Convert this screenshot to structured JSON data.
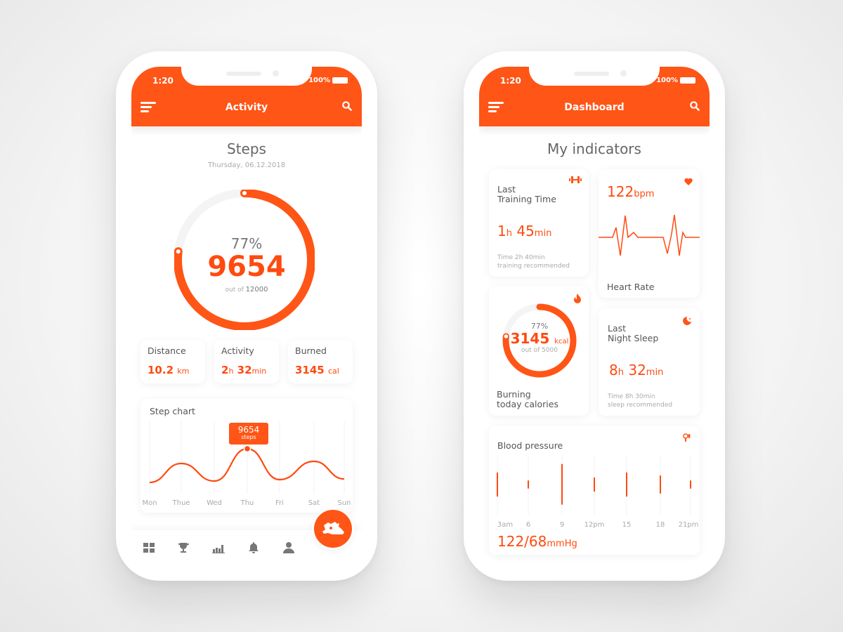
{
  "colors": {
    "accent": "#FF5516",
    "text": "#555555",
    "muted": "#AAAAAA"
  },
  "status_bar": {
    "time": "1:20",
    "battery": "100%"
  },
  "activity_screen": {
    "header": {
      "title": "Activity",
      "menu_icon": "menu-icon",
      "search_icon": "search-icon"
    },
    "title": "Steps",
    "date": "Thursday, 06.12.2018",
    "ring": {
      "percent_label": "77%",
      "progress": 0.77,
      "value": "9654",
      "goal_prefix": "out of",
      "goal": "12000"
    },
    "stats": [
      {
        "label": "Distance",
        "value": "10.2",
        "unit": "km"
      },
      {
        "label": "Activity",
        "value_h": "2",
        "unit_h": "h",
        "value_m": "32",
        "unit_m": "min"
      },
      {
        "label": "Burned",
        "value": "3145",
        "unit": "cal"
      }
    ],
    "step_chart": {
      "title": "Step chart",
      "tooltip_value": "9654",
      "tooltip_unit": "steps"
    },
    "nav": {
      "items": [
        "dashboard-icon",
        "trophy-icon",
        "stats-icon",
        "bell-icon",
        "profile-icon"
      ],
      "fab": "sneaker-icon"
    }
  },
  "dashboard_screen": {
    "header": {
      "title": "Dashboard",
      "menu_icon": "menu-icon",
      "search_icon": "search-icon"
    },
    "title": "My indicators",
    "training": {
      "label1": "Last",
      "label2": "Training Time",
      "h": "1",
      "h_unit": "h",
      "m": "45",
      "m_unit": "min",
      "note1": "Time 2h 40min",
      "note2": "training  recommended"
    },
    "heart": {
      "value": "122",
      "unit": "bpm",
      "label": "Heart Rate"
    },
    "calories": {
      "percent_label": "77%",
      "progress": 0.77,
      "value": "3145",
      "unit": "kcal",
      "goal": "out of 5000",
      "label1": "Burning",
      "label2": "today calories"
    },
    "sleep": {
      "label1": "Last",
      "label2": "Night Sleep",
      "h": "8",
      "h_unit": "h",
      "m": "32",
      "m_unit": "min",
      "note1": "Time 8h 30min",
      "note2": "sleep  recommended"
    },
    "blood_pressure": {
      "title": "Blood pressure",
      "value": "122/68",
      "unit": "mmHg"
    }
  },
  "chart_data": [
    {
      "type": "line",
      "title": "Step chart",
      "categories": [
        "Mon",
        "Thue",
        "Wed",
        "Thu",
        "Fri",
        "Sat",
        "Sun"
      ],
      "values": [
        2050,
        6330,
        2370,
        9654,
        2690,
        6800,
        2850
      ],
      "highlight": {
        "category": "Thu",
        "value": 9654
      },
      "grid": true
    },
    {
      "type": "bar",
      "title": "Blood pressure",
      "categories": [
        "3am",
        "6",
        "9",
        "12pm",
        "15",
        "18",
        "21pm"
      ],
      "series": [
        {
          "name": "high",
          "values": [
            124,
            108,
            141,
            114,
            124,
            118,
            108
          ]
        },
        {
          "name": "low",
          "values": [
            76,
            92,
            60,
            86,
            76,
            82,
            92
          ]
        }
      ],
      "grid": true
    }
  ]
}
